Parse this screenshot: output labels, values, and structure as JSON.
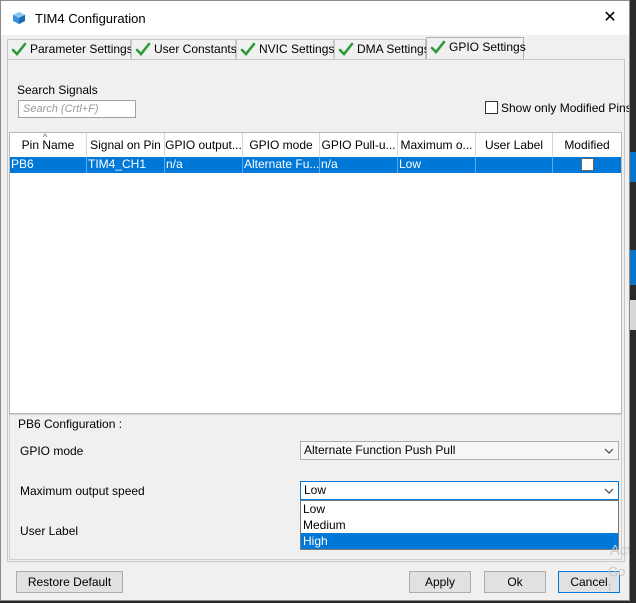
{
  "window": {
    "title": "TIM4 Configuration"
  },
  "tabs": [
    {
      "label": "Parameter Settings",
      "active": false
    },
    {
      "label": "User Constants",
      "active": false
    },
    {
      "label": "NVIC Settings",
      "active": false
    },
    {
      "label": "DMA Settings",
      "active": false
    },
    {
      "label": "GPIO Settings",
      "active": true
    }
  ],
  "search": {
    "label": "Search Signals",
    "placeholder": "Search (Crtl+F)",
    "value": ""
  },
  "show_modified": {
    "label": "Show only Modified Pins",
    "checked": false
  },
  "table": {
    "columns": [
      "Pin Name",
      "Signal on Pin",
      "GPIO output...",
      "GPIO mode",
      "GPIO Pull-u...",
      "Maximum o...",
      "User Label",
      "Modified"
    ],
    "rows": [
      {
        "pin": "PB6",
        "signal": "TIM4_CH1",
        "output": "n/a",
        "mode": "Alternate Fu...",
        "pull": "n/a",
        "speed": "Low",
        "user_label": "",
        "modified": false,
        "selected": true
      }
    ]
  },
  "config": {
    "title": "PB6 Configuration :",
    "gpio_mode": {
      "label": "GPIO mode",
      "value": "Alternate Function Push Pull"
    },
    "speed": {
      "label": "Maximum output speed",
      "value": "Low",
      "options": [
        "Low",
        "Medium",
        "High"
      ],
      "highlighted": "High"
    },
    "user_label": {
      "label": "User Label"
    }
  },
  "buttons": {
    "restore": "Restore Default",
    "apply": "Apply",
    "ok": "Ok",
    "cancel": "Cancel"
  },
  "watermark": [
    "Act",
    "Go t"
  ],
  "colors": {
    "accent": "#0078d7",
    "check": "#2e9b3a"
  }
}
